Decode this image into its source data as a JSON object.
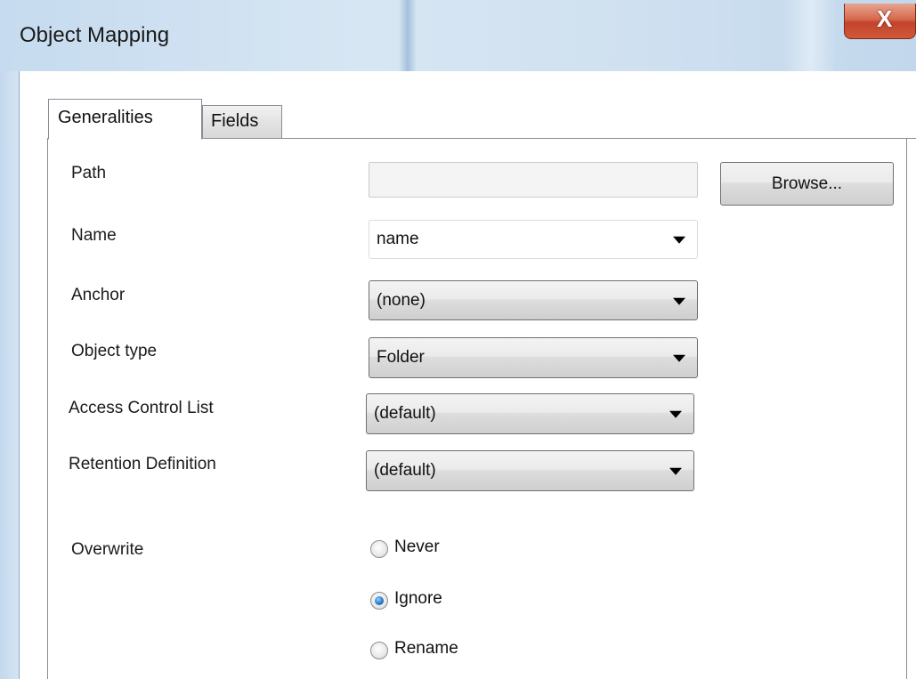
{
  "window": {
    "title": "Object Mapping",
    "close_glyph": "X"
  },
  "tabs": [
    {
      "label": "Generalities",
      "active": true
    },
    {
      "label": "Fields",
      "active": false
    }
  ],
  "form": {
    "path_label": "Path",
    "path_value": "",
    "browse_label": "Browse...",
    "name_label": "Name",
    "name_value": "name",
    "anchor_label": "Anchor",
    "anchor_value": "(none)",
    "object_type_label": "Object type",
    "object_type_value": "Folder",
    "acl_label": "Access Control List",
    "acl_value": "(default)",
    "retention_label": "Retention Definition",
    "retention_value": "(default)",
    "overwrite_label": "Overwrite",
    "overwrite_options": [
      {
        "label": "Never",
        "selected": false
      },
      {
        "label": "Ignore",
        "selected": true
      },
      {
        "label": "Rename",
        "selected": false
      }
    ]
  }
}
